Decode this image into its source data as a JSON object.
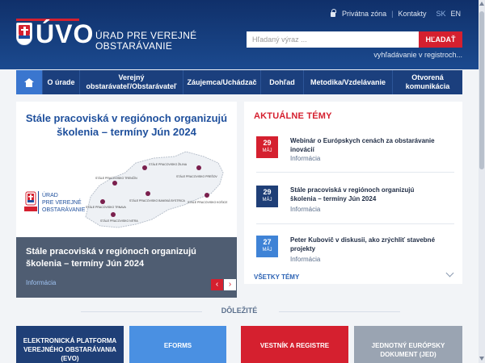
{
  "brand": {
    "logo_text": "ÚVO",
    "subtitle_line1": "ÚRAD PRE VEREJNÉ",
    "subtitle_line2": "OBSTARÁVANIE",
    "red": "#d5202f",
    "navy": "#10306a"
  },
  "top_links": {
    "private_zone": "Privátna zóna",
    "contacts": "Kontakty",
    "lang_sk": "SK",
    "lang_en": "EN"
  },
  "search": {
    "placeholder": "Hľadaný výraz ...",
    "button": "HĽADAŤ",
    "advanced": "vyhľadávanie v registroch..."
  },
  "nav": {
    "home_icon": "home-icon",
    "items": [
      {
        "line1": "O úrade",
        "line2": ""
      },
      {
        "line1": "Verejný",
        "line2": "obstarávateľ/Obstarávateľ"
      },
      {
        "line1": "Záujemca/Uchádzač",
        "line2": ""
      },
      {
        "line1": "Dohľad",
        "line2": ""
      },
      {
        "line1": "Metodika/Vzdelávanie",
        "line2": ""
      },
      {
        "line1": "Otvorená",
        "line2": "komunikácia"
      }
    ]
  },
  "slider": {
    "title_line1": "Stále pracoviská v regiónoch organizujú",
    "title_line2": "školenia – termíny Jún 2024",
    "map_logo_line1": "ÚRAD",
    "map_logo_line2": "PRE VEREJNÉ",
    "map_logo_line3": "OBSTARÁVANIE",
    "map_labels": [
      "STÁLE PRACOVISKO ŽILINA",
      "STÁLE PRACOVISKO PREŠOV",
      "STÁLE PRACOVISKO TRENČÍN",
      "STÁLE PRACOVISKO BANSKÁ BYSTRICA",
      "STÁLE PRACOVISKO KOŠICE",
      "STÁLE PRACOVISKO TRNAVA",
      "STÁLE PRACOVISKO NITRA"
    ],
    "caption_line1": "Stále pracoviská v regiónoch organizujú",
    "caption_line2": "školenia – termíny Jún 2024",
    "caption_tag": "Informácia",
    "prev": "‹",
    "next": "›"
  },
  "topics": {
    "heading": "AKTUÁLNE TÉMY",
    "items": [
      {
        "day": "29",
        "month": "MÁJ",
        "color": "#d5202f",
        "title_line1": "Webinár o Európskych cenách za obstarávanie",
        "title_line2": "inovácií",
        "tag": "Informácia"
      },
      {
        "day": "29",
        "month": "MÁJ",
        "color": "#1f3f77",
        "title_line1": "Stále pracoviská v regiónoch organizujú",
        "title_line2": "školenia – termíny Jún 2024",
        "tag": "Informácia"
      },
      {
        "day": "27",
        "month": "MÁJ",
        "color": "#3f83d6",
        "title_line1": "Peter Kubovič v diskusii, ako zrýchliť stavebné",
        "title_line2": "projekty",
        "tag": "Informácia"
      }
    ],
    "all_label": "VŠETKY TÉMY"
  },
  "important": {
    "title": "DÔLEŽITÉ",
    "tiles": [
      {
        "text_line1": "ELEKTRONICKÁ PLATFORMA",
        "text_line2": "VEREJNÉHO OBSTARÁVANIA",
        "text_line3": "(EVO)",
        "color": "#1f3f77"
      },
      {
        "text_line1": "EFORMS",
        "text_line2": "",
        "text_line3": "",
        "color": "#4a90e2"
      },
      {
        "text_line1": "VESTNÍK A REGISTRE",
        "text_line2": "",
        "text_line3": "",
        "color": "#d5202f"
      },
      {
        "text_line1": "JEDNOTNÝ EURÓPSKY",
        "text_line2": "DOKUMENT (JED)",
        "text_line3": "",
        "color": "#9aa4b2"
      }
    ]
  }
}
